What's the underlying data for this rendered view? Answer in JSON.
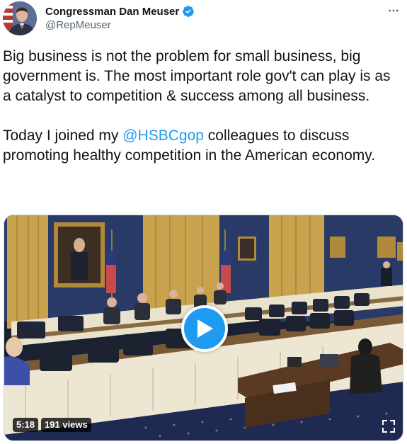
{
  "author": {
    "display_name": "Congressman Dan Meuser",
    "handle": "@RepMeuser",
    "verified": true
  },
  "icons": {
    "verified": "verified-badge-icon",
    "more": "more-options-icon",
    "play": "play-icon",
    "expand": "expand-icon"
  },
  "tweet": {
    "paragraph_1": "Big business is not the problem for small business, big government is. The most important role gov't can play is as a catalyst to competition & success among all business.",
    "paragraph_2_before": "Today I joined my ",
    "paragraph_2_mention": "@HSBCgop",
    "paragraph_2_after": " colleagues to discuss promoting healthy competition in the American economy."
  },
  "video": {
    "duration": "5:18",
    "views": "191 views"
  },
  "colors": {
    "accent": "#1d9bf0",
    "text": "#0f1419",
    "secondary": "#536471"
  }
}
